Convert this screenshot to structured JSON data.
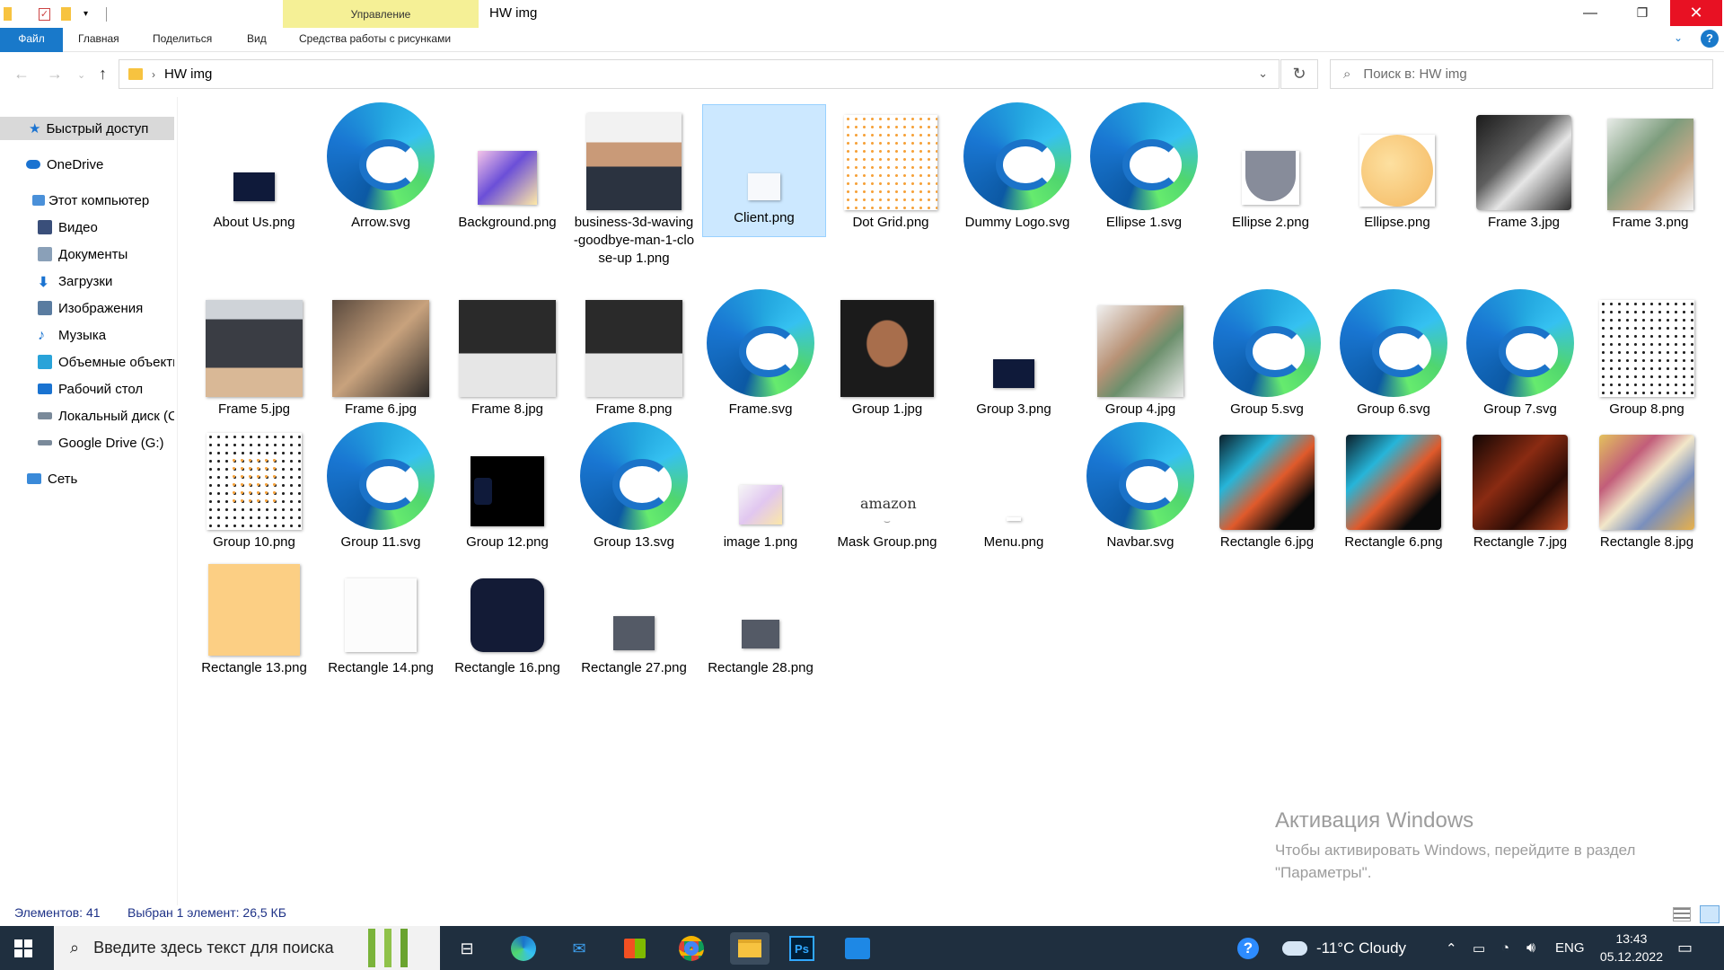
{
  "window": {
    "title": "HW img",
    "context_tab_header": "Управление",
    "buttons": {
      "minimize": "—",
      "maximize": "❐",
      "close": "✕"
    }
  },
  "ribbon": {
    "tabs": [
      "Файл",
      "Главная",
      "Поделиться",
      "Вид",
      "Средства работы с рисунками"
    ]
  },
  "address_bar": {
    "path": "HW img",
    "search_placeholder": "Поиск в: HW img"
  },
  "nav_pane": {
    "items": [
      {
        "label": "Быстрый доступ",
        "icon": "star-icon",
        "color": "#1a73d1"
      },
      {
        "label": "OneDrive",
        "icon": "cloud-icon",
        "color": "#1a73d1"
      },
      {
        "label": "Этот компьютер",
        "icon": "computer-icon",
        "color": "#4a90d9"
      },
      {
        "label": "Видео",
        "icon": "video-folder-icon",
        "color": "#3a4f7a"
      },
      {
        "label": "Документы",
        "icon": "documents-folder-icon",
        "color": "#8aa0b8"
      },
      {
        "label": "Загрузки",
        "icon": "downloads-folder-icon",
        "color": "#1a73d1"
      },
      {
        "label": "Изображения",
        "icon": "pictures-folder-icon",
        "color": "#5a7ca0"
      },
      {
        "label": "Музыка",
        "icon": "music-folder-icon",
        "color": "#1a73d1"
      },
      {
        "label": "Объемные объекты",
        "icon": "3d-objects-folder-icon",
        "color": "#29a3d9"
      },
      {
        "label": "Рабочий стол",
        "icon": "desktop-folder-icon",
        "color": "#1a73d1"
      },
      {
        "label": "Локальный диск (C:)",
        "icon": "drive-icon",
        "color": "#7a8a9a"
      },
      {
        "label": "Google Drive (G:)",
        "icon": "drive-icon",
        "color": "#7a8a9a"
      },
      {
        "label": "Сеть",
        "icon": "network-icon",
        "color": "#3a8ad9"
      }
    ]
  },
  "files": [
    {
      "name": "About Us.png"
    },
    {
      "name": "Arrow.svg"
    },
    {
      "name": "Background.png"
    },
    {
      "name": "business-3d-waving-goodbye-man-1-close-up 1.png"
    },
    {
      "name": "Client.png"
    },
    {
      "name": "Dot Grid.png"
    },
    {
      "name": "Dummy Logo.svg"
    },
    {
      "name": "Ellipse 1.svg"
    },
    {
      "name": "Ellipse 2.png"
    },
    {
      "name": "Ellipse.png"
    },
    {
      "name": "Frame 3.jpg"
    },
    {
      "name": "Frame 3.png"
    },
    {
      "name": "Frame 5.jpg"
    },
    {
      "name": "Frame 6.jpg"
    },
    {
      "name": "Frame 8.jpg"
    },
    {
      "name": "Frame 8.png"
    },
    {
      "name": "Frame.svg"
    },
    {
      "name": "Group 1.jpg"
    },
    {
      "name": "Group 3.png"
    },
    {
      "name": "Group 4.jpg"
    },
    {
      "name": "Group 5.svg"
    },
    {
      "name": "Group 6.svg"
    },
    {
      "name": "Group 7.svg"
    },
    {
      "name": "Group 8.png"
    },
    {
      "name": "Group 10.png"
    },
    {
      "name": "Group 11.svg"
    },
    {
      "name": "Group 12.png"
    },
    {
      "name": "Group 13.svg"
    },
    {
      "name": "image 1.png"
    },
    {
      "name": "Mask Group.png"
    },
    {
      "name": "Menu.png"
    },
    {
      "name": "Navbar.svg"
    },
    {
      "name": "Rectangle 6.jpg"
    },
    {
      "name": "Rectangle 6.png"
    },
    {
      "name": "Rectangle 7.jpg"
    },
    {
      "name": "Rectangle 8.jpg"
    },
    {
      "name": "Rectangle 13.png"
    },
    {
      "name": "Rectangle 14.png"
    },
    {
      "name": "Rectangle 16.png"
    },
    {
      "name": "Rectangle 27.png"
    },
    {
      "name": "Rectangle 28.png"
    }
  ],
  "status_bar": {
    "count": "Элементов: 41",
    "selection": "Выбран 1 элемент: 26,5 КБ"
  },
  "watermark": {
    "title": "Активация Windows",
    "line1": "Чтобы активировать Windows, перейдите в раздел",
    "line2": "\"Параметры\"."
  },
  "taskbar": {
    "search_placeholder": "Введите здесь текст для поиска",
    "weather": "-11°C  Cloudy",
    "language": "ENG",
    "time": "13:43",
    "date": "05.12.2022"
  }
}
